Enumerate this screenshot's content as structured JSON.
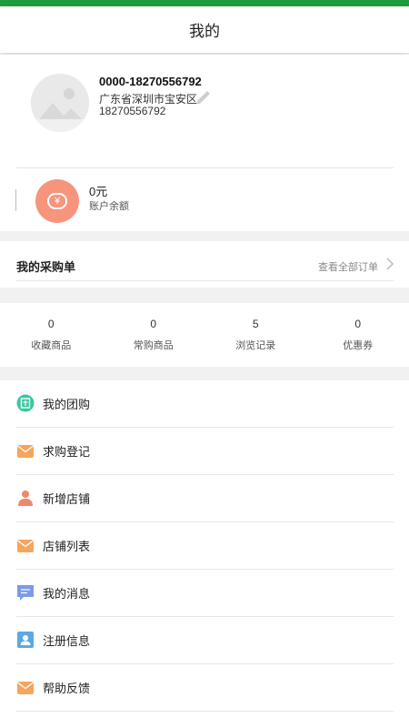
{
  "header": {
    "title": "我的"
  },
  "profile": {
    "name": "0000-18270556792",
    "address": "广东省深圳市宝安区",
    "phone": "18270556792",
    "avatar_icon": "avatar-placeholder-icon",
    "edit_icon": "pencil-icon"
  },
  "balance": {
    "amount": "0元",
    "label": "账户余额",
    "icon": "yen-wallet-icon",
    "icon_color": "#f7947c"
  },
  "orders": {
    "label": "我的采购单",
    "link": "查看全部订单"
  },
  "stats": [
    {
      "value": "0",
      "label": "收藏商品"
    },
    {
      "value": "0",
      "label": "常购商品"
    },
    {
      "value": "5",
      "label": "浏览记录"
    },
    {
      "value": "0",
      "label": "优惠券"
    }
  ],
  "menu": [
    {
      "label": "我的团购",
      "icon": "group-buy-icon"
    },
    {
      "label": "求购登记",
      "icon": "envelope-icon"
    },
    {
      "label": "新增店铺",
      "icon": "person-icon"
    },
    {
      "label": "店铺列表",
      "icon": "envelope-icon"
    },
    {
      "label": "我的消息",
      "icon": "message-icon"
    },
    {
      "label": "注册信息",
      "icon": "profile-card-icon"
    },
    {
      "label": "帮助反馈",
      "icon": "envelope-icon"
    }
  ],
  "colors": {
    "status_bar": "#1f9d3d",
    "accent_orange": "#f7947c",
    "group_green": "#3cc6a0",
    "mail_orange": "#f5a55c"
  }
}
